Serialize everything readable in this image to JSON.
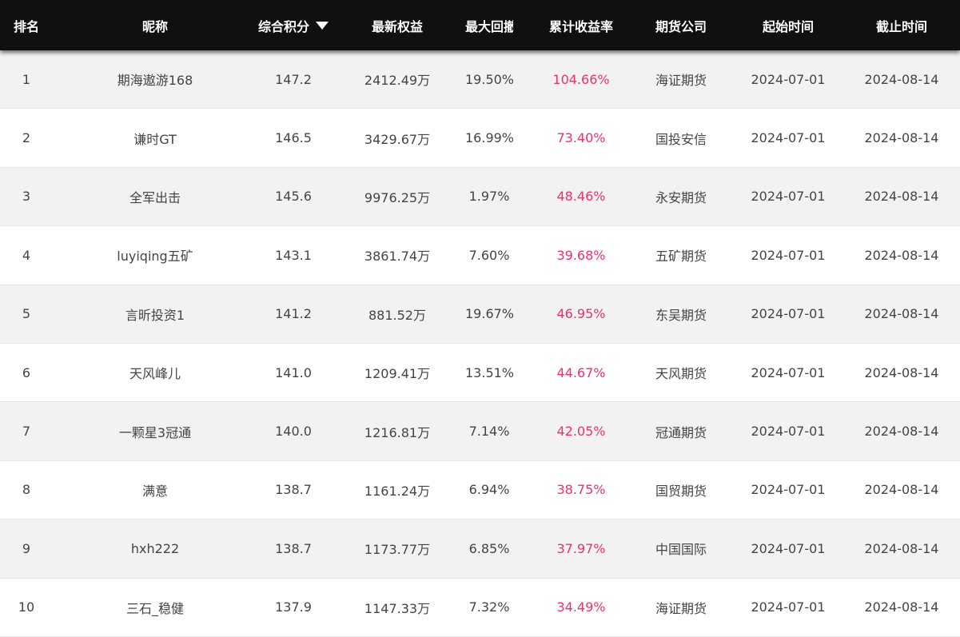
{
  "header": {
    "rank": "排名",
    "name": "昵称",
    "score": "综合积分",
    "equity": "最新权益",
    "drawdown": "最大回撤",
    "return": "累计收益率",
    "company": "期货公司",
    "start": "起始时间",
    "end": "截止时间",
    "sort_icon": "triangle-down-icon"
  },
  "colors": {
    "header_bg": "#101010",
    "row_odd": "#f2f2f2",
    "row_even": "#ffffff",
    "return_color": "#e8336d"
  },
  "rows": [
    {
      "rank": "1",
      "name": "期海遨游168",
      "score": "147.2",
      "equity": "2412.49万",
      "drawdown": "19.50%",
      "return": "104.66%",
      "company": "海证期货",
      "start": "2024-07-01",
      "end": "2024-08-14"
    },
    {
      "rank": "2",
      "name": "谦时GT",
      "score": "146.5",
      "equity": "3429.67万",
      "drawdown": "16.99%",
      "return": "73.40%",
      "company": "国投安信",
      "start": "2024-07-01",
      "end": "2024-08-14"
    },
    {
      "rank": "3",
      "name": "全军出击",
      "score": "145.6",
      "equity": "9976.25万",
      "drawdown": "1.97%",
      "return": "48.46%",
      "company": "永安期货",
      "start": "2024-07-01",
      "end": "2024-08-14"
    },
    {
      "rank": "4",
      "name": "luyiqing五矿",
      "score": "143.1",
      "equity": "3861.74万",
      "drawdown": "7.60%",
      "return": "39.68%",
      "company": "五矿期货",
      "start": "2024-07-01",
      "end": "2024-08-14"
    },
    {
      "rank": "5",
      "name": "言昕投资1",
      "score": "141.2",
      "equity": "881.52万",
      "drawdown": "19.67%",
      "return": "46.95%",
      "company": "东吴期货",
      "start": "2024-07-01",
      "end": "2024-08-14"
    },
    {
      "rank": "6",
      "name": "天风峰儿",
      "score": "141.0",
      "equity": "1209.41万",
      "drawdown": "13.51%",
      "return": "44.67%",
      "company": "天风期货",
      "start": "2024-07-01",
      "end": "2024-08-14"
    },
    {
      "rank": "7",
      "name": "一颗星3冠通",
      "score": "140.0",
      "equity": "1216.81万",
      "drawdown": "7.14%",
      "return": "42.05%",
      "company": "冠通期货",
      "start": "2024-07-01",
      "end": "2024-08-14"
    },
    {
      "rank": "8",
      "name": "满意",
      "score": "138.7",
      "equity": "1161.24万",
      "drawdown": "6.94%",
      "return": "38.75%",
      "company": "国贸期货",
      "start": "2024-07-01",
      "end": "2024-08-14"
    },
    {
      "rank": "9",
      "name": "hxh222",
      "score": "138.7",
      "equity": "1173.77万",
      "drawdown": "6.85%",
      "return": "37.97%",
      "company": "中国国际",
      "start": "2024-07-01",
      "end": "2024-08-14"
    },
    {
      "rank": "10",
      "name": "三石_稳健",
      "score": "137.9",
      "equity": "1147.33万",
      "drawdown": "7.32%",
      "return": "34.49%",
      "company": "海证期货",
      "start": "2024-07-01",
      "end": "2024-08-14"
    }
  ]
}
